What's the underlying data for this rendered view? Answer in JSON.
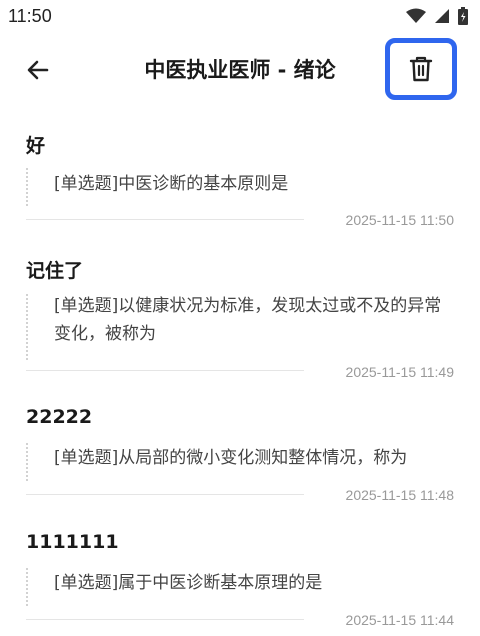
{
  "status": {
    "time": "11:50"
  },
  "header": {
    "title": "中医执业医师 - 绪论"
  },
  "items": [
    {
      "title": "好",
      "question": "[单选题]中医诊断的基本原则是",
      "time": "2025-11-15 11:50"
    },
    {
      "title": "记住了",
      "question": "[单选题]以健康状况为标准，发现太过或不及的异常变化，被称为",
      "time": "2025-11-15 11:49"
    },
    {
      "title": "22222",
      "question": "[单选题]从局部的微小变化测知整体情况，称为",
      "time": "2025-11-15 11:48"
    },
    {
      "title": "1111111",
      "question": "[单选题]属于中医诊断基本原理的是",
      "time": "2025-11-15 11:44"
    }
  ],
  "icons": {
    "back": "arrow-left-icon",
    "delete": "trash-icon",
    "wifi": "wifi-icon",
    "signal": "signal-icon",
    "battery": "battery-icon"
  },
  "colors": {
    "highlight": "#2f66ee",
    "text": "#1a1a1a",
    "muted": "#999999"
  }
}
